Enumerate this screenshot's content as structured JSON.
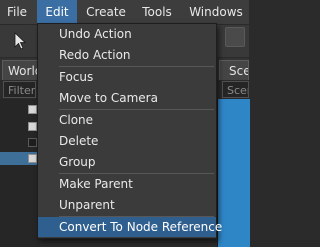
{
  "menubar": {
    "items": [
      {
        "label": "File"
      },
      {
        "label": "Edit",
        "active": true
      },
      {
        "label": "Create"
      },
      {
        "label": "Tools"
      },
      {
        "label": "Windows"
      }
    ]
  },
  "world_panel": {
    "tab_label": "World",
    "filter_placeholder": "Filter"
  },
  "scene_panel": {
    "tab_label": "Scene",
    "field_placeholder": "Scene"
  },
  "edit_menu": {
    "items": [
      {
        "label": "Undo Action"
      },
      {
        "label": "Redo Action"
      },
      {
        "label": "Focus"
      },
      {
        "label": "Move to Camera"
      },
      {
        "label": "Clone"
      },
      {
        "label": "Delete"
      },
      {
        "label": "Group"
      },
      {
        "label": "Make Parent"
      },
      {
        "label": "Unparent"
      },
      {
        "label": "Convert To Node Reference",
        "highlighted": true
      }
    ]
  },
  "colors": {
    "menu_highlight": "#2f5f8f",
    "menubar_active": "#3b6fa4",
    "viewport_blue": "#2f86c6"
  },
  "icons": {
    "toolbar_tool": "arrow-pointer-icon"
  }
}
